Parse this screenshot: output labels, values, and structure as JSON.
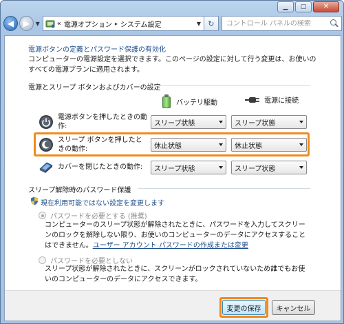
{
  "window": {
    "caption_buttons": {
      "minimize_icon": "minimize-icon",
      "maximize_icon": "maximize-icon",
      "close_icon": "close-icon"
    }
  },
  "navbar": {
    "back_glyph": "◀",
    "forward_glyph": "▶",
    "dropdown_glyph": "▼",
    "breadcrumb_prefix": "«",
    "breadcrumb": [
      "電源オプション",
      "システム設定"
    ],
    "breadcrumb_sep": "▸",
    "refresh_glyph": "↻",
    "search_placeholder": "コントロール パネルの検索"
  },
  "header": {
    "title_link": "電源ボタンの定義とパスワード保護の有効化",
    "description": "コンピューターの電源設定を選択できます。このページの設定に対して行う変更は、お使いのすべての電源プランに適用されます。"
  },
  "power_section": {
    "heading": "電源とスリープ ボタンおよびカバーの設定",
    "col_battery": "バッテリ駆動",
    "col_plugged": "電源に接続",
    "rows": [
      {
        "label": "電源ボタンを押したときの動作:",
        "battery": "スリープ状態",
        "plugged": "スリープ状態",
        "icon": "power-button-icon"
      },
      {
        "label": "スリープ ボタンを押したときの動作:",
        "battery": "休止状態",
        "plugged": "休止状態",
        "icon": "sleep-button-icon"
      },
      {
        "label": "カバーを閉じたときの動作:",
        "battery": "スリープ状態",
        "plugged": "スリープ状態",
        "icon": "laptop-lid-icon"
      }
    ]
  },
  "password_section": {
    "heading": "スリープ解除時のパスワード保護",
    "change_link": "現在利用可能ではない設定を変更します",
    "options": [
      {
        "label": "パスワードを必要とする (推奨)",
        "checked": true,
        "desc_before": "コンピューターのスリープ状態が解除されたときに、パスワードを入力してスクリーンのロックを解除しない限り、お使いのコンピューターのデータにアクセスすることはできません。",
        "desc_link": "ユーザー アカウント パスワードの作成または変更"
      },
      {
        "label": "パスワードを必要としない",
        "checked": false,
        "desc_before": "スリープ状態が解除されたときに、スクリーンがロックされていないため誰でもお使いのコンピューターのデータにアクセスできます。",
        "desc_link": ""
      }
    ]
  },
  "footer": {
    "save_label": "変更の保存",
    "cancel_label": "キャンセル"
  },
  "colors": {
    "highlight": "#f08a1c",
    "link": "#1f4e8c"
  }
}
